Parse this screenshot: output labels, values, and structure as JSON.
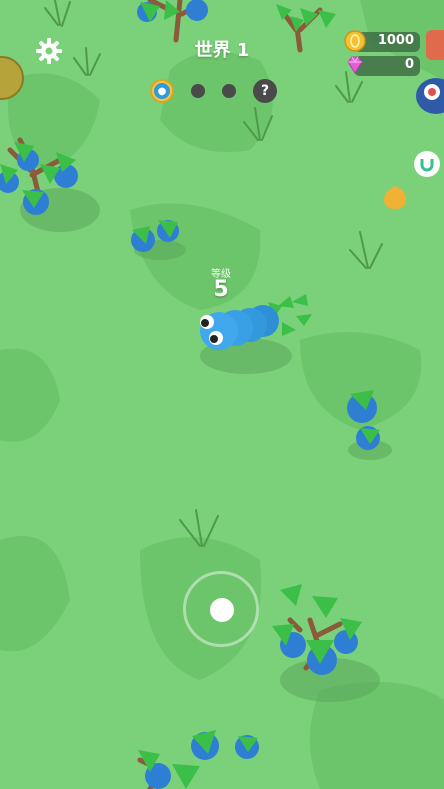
{
  "hud": {
    "world_title": "世界 1",
    "coins": "1000",
    "gems": "0",
    "stage_unknown_symbol": "?",
    "stages": [
      {
        "state": "current",
        "icon": "water-drop-icon"
      },
      {
        "state": "locked"
      },
      {
        "state": "locked"
      },
      {
        "state": "unknown"
      }
    ]
  },
  "player": {
    "level_label": "等级",
    "level_value": "5",
    "color": "#3aa0e6"
  },
  "icons": {
    "settings": "gear-icon",
    "coin": "coin-icon",
    "gem": "gem-icon",
    "magnet": "magnet-icon"
  },
  "colors": {
    "grass": "#7bd07a",
    "grass_patch": "#6cc46b",
    "snake": "#3aa0e6",
    "coin": "#f2c232",
    "gem": "#e25fd6",
    "berry": "#2e7fd4",
    "leaf": "#3bbf48"
  }
}
